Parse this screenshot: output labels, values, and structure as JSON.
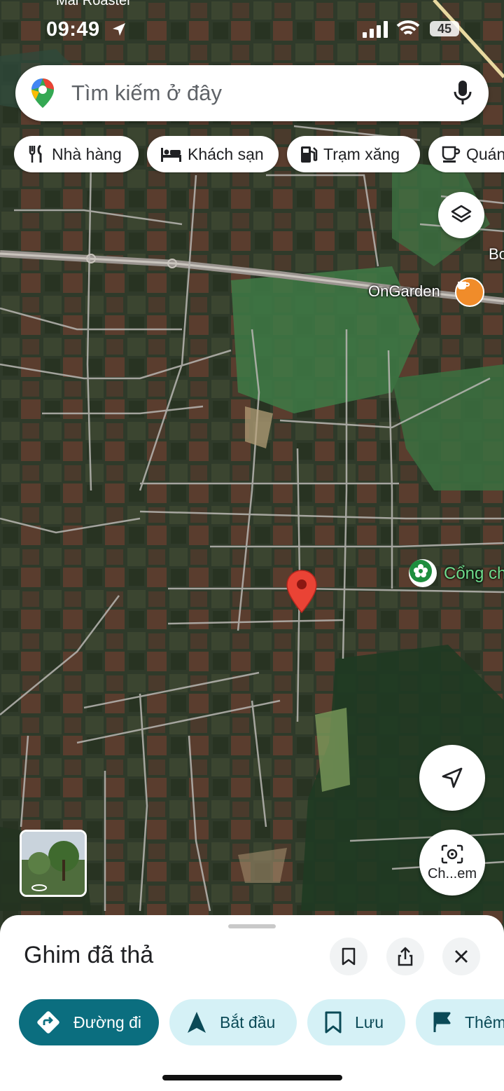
{
  "status_bar": {
    "time": "09:49",
    "battery": "45",
    "top_label": "Mai Roaster"
  },
  "search": {
    "placeholder": "Tìm kiếm ở đây"
  },
  "chips": [
    {
      "label": "Nhà hàng",
      "icon": "restaurant-icon"
    },
    {
      "label": "Khách sạn",
      "icon": "hotel-icon"
    },
    {
      "label": "Trạm xăng",
      "icon": "gas-station-icon"
    },
    {
      "label": "Quán",
      "icon": "cafe-icon"
    }
  ],
  "map": {
    "place_labels": {
      "ongarden": "OnGarden",
      "partial_b": "Bo",
      "park": "Cổng ch"
    },
    "street_view_thumb": "street-view-thumbnail"
  },
  "camera_button": {
    "label": "Ch...em"
  },
  "sheet": {
    "title": "Ghim đã thả",
    "actions": [
      {
        "label": "Đường đi",
        "icon": "directions-icon"
      },
      {
        "label": "Bắt đầu",
        "icon": "navigation-arrow-icon"
      },
      {
        "label": "Lưu",
        "icon": "bookmark-icon"
      },
      {
        "label": "Thêm",
        "icon": "flag-icon"
      }
    ]
  },
  "colors": {
    "primary_action": "#0b6e7f",
    "secondary_action": "#d5f1f6",
    "pin_red": "#ea4335"
  }
}
